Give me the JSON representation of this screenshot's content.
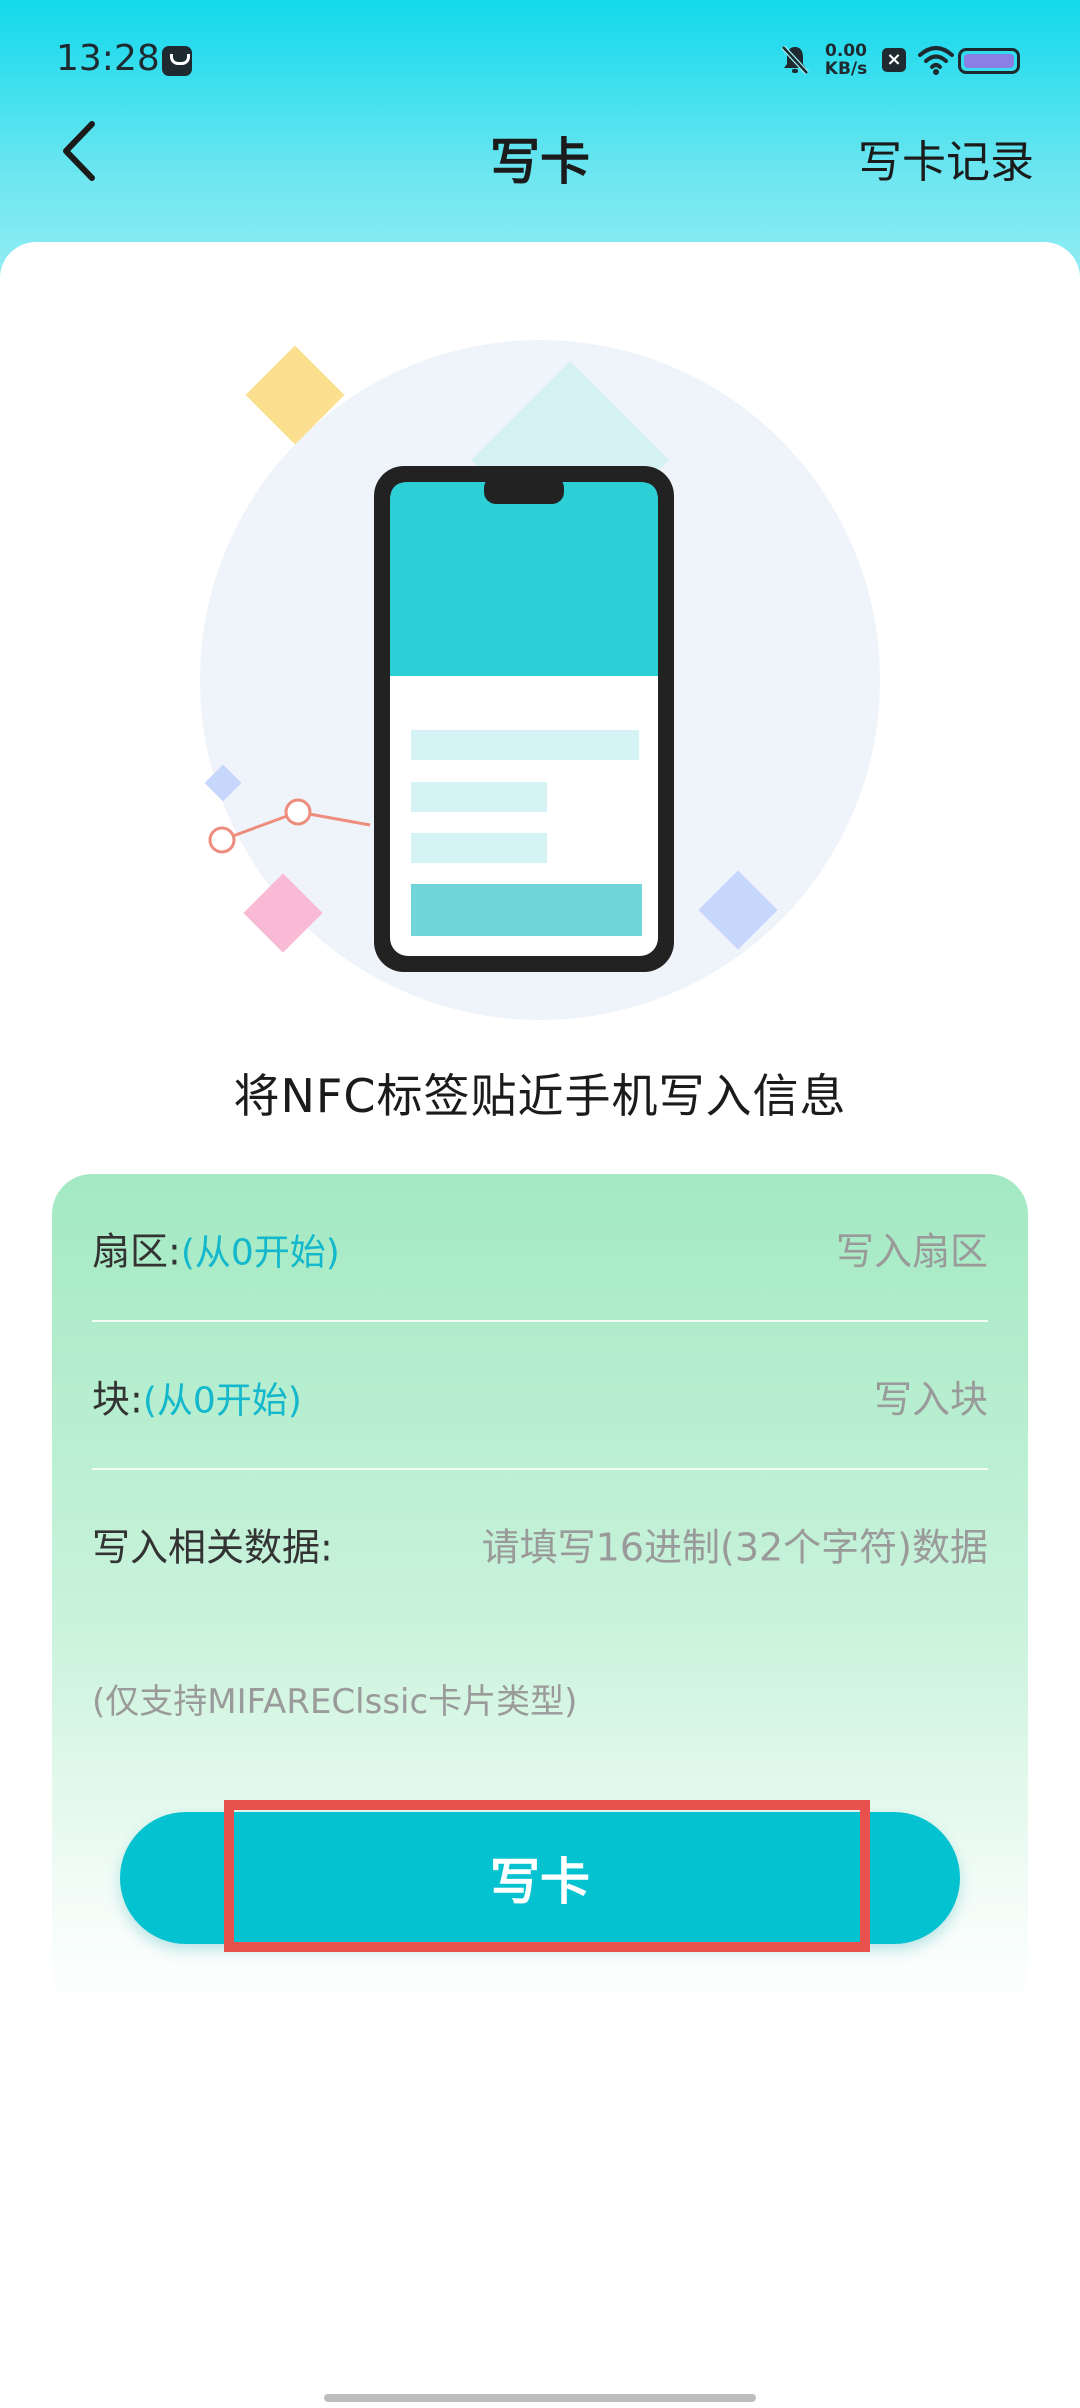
{
  "status_bar": {
    "time": "13:28",
    "net_speed_value": "0.00",
    "net_speed_unit": "KB/s",
    "icons": [
      "app-notification-icon",
      "mute-icon",
      "x-icon",
      "wifi-icon",
      "battery-icon"
    ]
  },
  "nav": {
    "back_icon": "chevron-left-icon",
    "title": "写卡",
    "history_label": "写卡记录"
  },
  "hint": "将NFC标签贴近手机写入信息",
  "form": {
    "sector": {
      "label": "扇区:",
      "hint": "(从0开始)",
      "placeholder": "写入扇区"
    },
    "block": {
      "label": "块:",
      "hint": "(从0开始)",
      "placeholder": "写入块"
    },
    "data": {
      "label": "写入相关数据:",
      "placeholder": "请填写16进制(32个字符)数据"
    },
    "note": "(仅支持MIFAREClssic卡片类型)"
  },
  "write_button_label": "写卡",
  "colors": {
    "accent": "#05c2d1",
    "hint_text": "#14b8cc",
    "highlight": "#e8514c"
  }
}
